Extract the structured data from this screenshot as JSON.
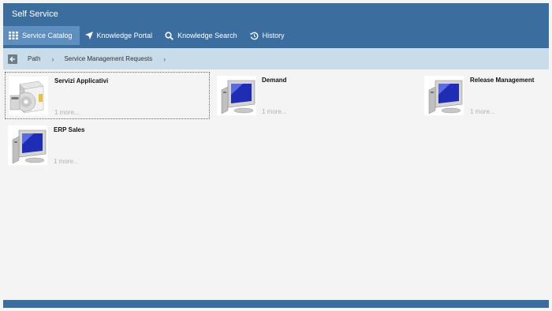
{
  "app": {
    "title": "Self Service"
  },
  "tabs": [
    {
      "label": "Service Catalog",
      "icon": "grid-icon",
      "active": true
    },
    {
      "label": "Knowledge Portal",
      "icon": "navigation-arrow-icon"
    },
    {
      "label": "Knowledge Search",
      "icon": "search-icon"
    },
    {
      "label": "History",
      "icon": "history-icon"
    }
  ],
  "breadcrumb": {
    "items": [
      "Path",
      "Service Management Requests"
    ]
  },
  "catalog": {
    "items": [
      {
        "title": "Servizi Applicativi",
        "more": "1 more...",
        "icon": "software-box-icon"
      },
      {
        "title": "Demand",
        "more": "1 more...",
        "icon": "computer-icon"
      },
      {
        "title": "Release Management",
        "more": "1 more...",
        "icon": "computer-icon"
      },
      {
        "title": "ERP Sales",
        "more": "1 more...",
        "icon": "computer-icon"
      }
    ]
  },
  "colors": {
    "header": "#3b6e9f",
    "active_tab": "#5f8fbf",
    "breadcrumb_bg": "#c8dcea",
    "page_bg": "#f4f4f4"
  }
}
